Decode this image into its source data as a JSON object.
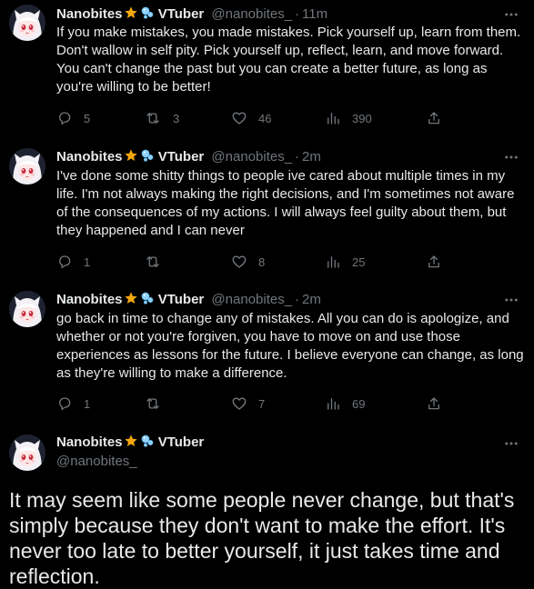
{
  "author": {
    "display_name": "Nanobites",
    "name_suffix": "VTuber",
    "handle": "@nanobites_",
    "separator": "·",
    "emoji_star": "star-emoji",
    "emoji_bubbles": "bubbles-emoji"
  },
  "colors": {
    "background": "#000000",
    "text": "#e7e9ea",
    "muted": "#71767b",
    "star": "#f4a80f",
    "bubbles": "#8fd3ff"
  },
  "tweets": [
    {
      "time": "11m",
      "text": "If you make mistakes, you made mistakes. Pick yourself up, learn from them. Don't wallow in self pity. Pick yourself up, reflect, learn, and move forward. You can't change the past but you can create a better future, as long as you're willing to be better!",
      "replies": "5",
      "retweets": "3",
      "likes": "46",
      "views": "390"
    },
    {
      "time": "2m",
      "text": "I've done some shitty things to people ive cared about multiple times in my life. I'm not always making the right decisions, and I'm sometimes not aware of the consequences of my actions. I will always feel guilty about them, but they happened and I can never",
      "replies": "1",
      "retweets": "",
      "likes": "8",
      "views": "25"
    },
    {
      "time": "2m",
      "text": "go back in time to change any of mistakes. All you can do is apologize, and whether or not you're forgiven, you have to move on and use those experiences as lessons for the future. I believe everyone can change, as long as they're willing to make a difference.",
      "replies": "1",
      "retweets": "",
      "likes": "7",
      "views": "69"
    }
  ],
  "focused_tweet": {
    "text": "It may seem like some people never change, but that's simply because they don't want to make the effort. It's never too late to better yourself, it just takes time and reflection."
  }
}
